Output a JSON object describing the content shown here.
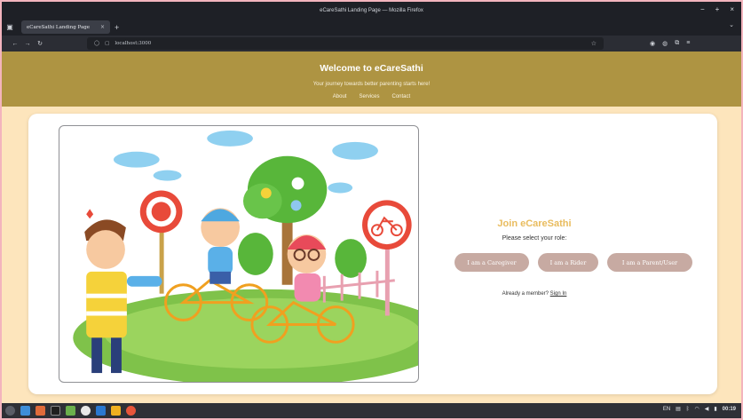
{
  "window": {
    "title": "eCareSathi Landing Page — Mozilla Firefox",
    "controls": [
      "−",
      "+",
      "×"
    ]
  },
  "browser": {
    "tab_title": "eCareSathi Landing Page",
    "tab_close": "×",
    "new_tab": "+",
    "url": "localhost:3000"
  },
  "hero": {
    "title": "Welcome to eCareSathi",
    "tagline": "Your journey towards better parenting starts here!",
    "nav": [
      "About",
      "Services",
      "Contact"
    ]
  },
  "join": {
    "title": "Join eCareSathi",
    "subtitle": "Please select your role:",
    "roles": [
      "I am a Caregiver",
      "I am a Rider",
      "I am a Parent/User"
    ],
    "already_text": "Already a member?",
    "signin_label": "Sign In"
  },
  "taskbar": {
    "lang": "EN",
    "clock": "00:19"
  },
  "colors": {
    "hero_bg": "#ae9442",
    "page_bg": "#fde5bc",
    "join_title": "#e9bc5e",
    "role_button": "#c7aaa2"
  }
}
